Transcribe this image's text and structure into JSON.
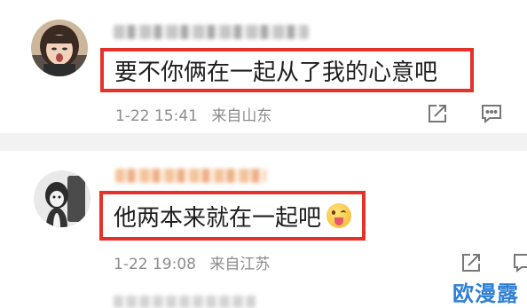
{
  "comments": [
    {
      "text": "要不你俩在一起从了我的心意吧",
      "date": "1-22 15:41",
      "location": "来自山东"
    },
    {
      "text": "他两本来就在一起吧",
      "emoji": "tongue-out-emoji",
      "date": "1-22 19:08",
      "location": "来自江苏"
    }
  ],
  "icons": {
    "share": "share-icon",
    "comment": "comment-icon"
  },
  "colors": {
    "highlight_border": "#e6312a",
    "meta_text": "#8c8c8c",
    "watermark": "#2f7fd6"
  },
  "watermark": "欧漫露"
}
